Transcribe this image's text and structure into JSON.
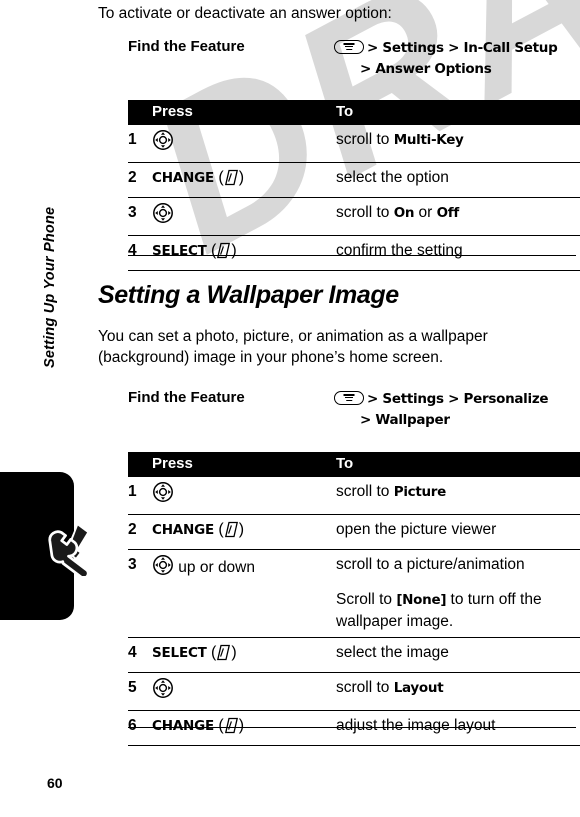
{
  "document": {
    "page_number": "60",
    "sidebar_label": "Setting Up Your Phone",
    "watermark": "DRAFT",
    "thumb_tab_icon": "wrench-screwdriver-icon"
  },
  "intro": {
    "text": "To activate or deactivate an answer option:"
  },
  "find_the_feature_1": {
    "label": "Find the Feature",
    "menu_icon": "menu-key-icon",
    "line1_items": [
      "Settings",
      "In-Call Setup"
    ],
    "line1": "> Settings > In-Call Setup",
    "line2": "> Answer Options",
    "separator": ">"
  },
  "table1": {
    "headers": {
      "num": "",
      "press": "Press",
      "to": "To"
    },
    "rows": [
      {
        "num": "1",
        "press_icon": "nav-key-icon",
        "press": "",
        "to_prefix": "scroll to ",
        "to_term": "Multi-Key",
        "to_suffix": ""
      },
      {
        "num": "2",
        "press_icon": "soft-key-icon",
        "press": "CHANGE",
        "to_prefix": "select the option",
        "to_term": "",
        "to_suffix": ""
      },
      {
        "num": "3",
        "press_icon": "nav-key-icon",
        "press": "",
        "to_prefix": "scroll to ",
        "to_term": "On",
        "to_mid": " or ",
        "to_term2": "Off",
        "to_suffix": ""
      },
      {
        "num": "4",
        "press_icon": "soft-key-icon",
        "press": "SELECT",
        "to_prefix": "confirm the setting",
        "to_term": "",
        "to_suffix": ""
      }
    ]
  },
  "section": {
    "title": "Setting a Wallpaper Image",
    "body": "You can set a photo, picture, or animation as a wallpaper (background) image in your phone’s home screen."
  },
  "find_the_feature_2": {
    "label": "Find the Feature",
    "menu_icon": "menu-key-icon",
    "line1": "> Settings > Personalize",
    "line2": "> Wallpaper",
    "separator": ">"
  },
  "table2": {
    "headers": {
      "num": "",
      "press": "Press",
      "to": "To"
    },
    "rows": [
      {
        "num": "1",
        "press_icon": "nav-key-icon",
        "press": "",
        "to_prefix": "scroll to ",
        "to_term": "Picture",
        "to_suffix": ""
      },
      {
        "num": "2",
        "press_icon": "soft-key-icon",
        "press": "CHANGE",
        "to_prefix": "open the picture viewer",
        "to_term": "",
        "to_suffix": ""
      },
      {
        "num": "3",
        "press_icon": "nav-key-icon",
        "press": " up or down",
        "to_prefix": "scroll to a picture/animation",
        "to_term": "",
        "to_suffix": "",
        "to_note_prefix": "Scroll to ",
        "to_note_term": "[None]",
        "to_note_suffix": " to turn off the wallpaper image."
      },
      {
        "num": "4",
        "press_icon": "soft-key-icon",
        "press": "SELECT",
        "to_prefix": "select the image",
        "to_term": "",
        "to_suffix": ""
      },
      {
        "num": "5",
        "press_icon": "nav-key-icon",
        "press": "",
        "to_prefix": "scroll to ",
        "to_term": "Layout",
        "to_suffix": ""
      },
      {
        "num": "6",
        "press_icon": "soft-key-icon",
        "press": "CHANGE",
        "to_prefix": "adjust the image layout",
        "to_term": "",
        "to_suffix": ""
      }
    ]
  }
}
